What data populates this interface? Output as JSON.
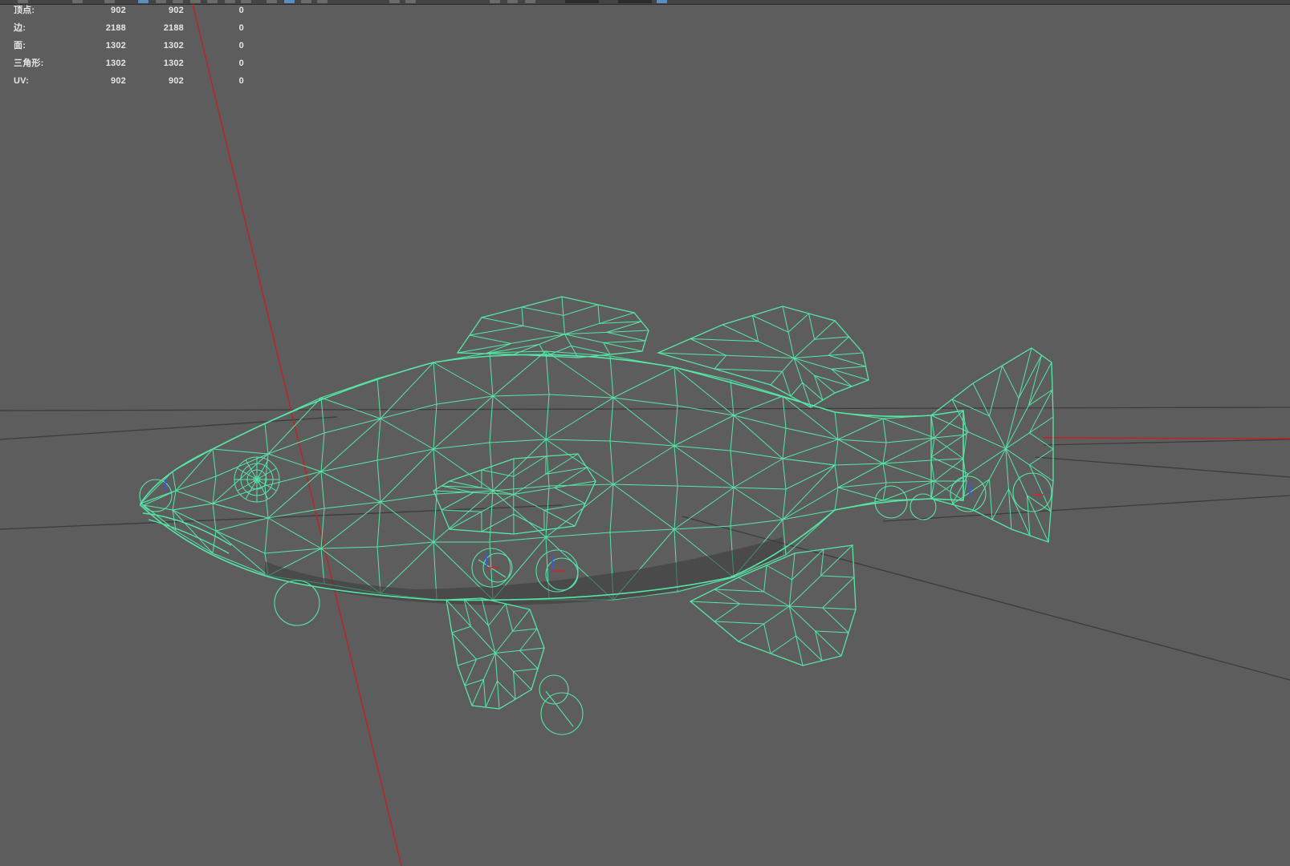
{
  "hud": {
    "rows": [
      {
        "label": "顶点:",
        "c1": "902",
        "c2": "902",
        "c3": "0"
      },
      {
        "label": "边:",
        "c1": "2188",
        "c2": "2188",
        "c3": "0"
      },
      {
        "label": "面:",
        "c1": "1302",
        "c2": "1302",
        "c3": "0"
      },
      {
        "label": "三角形:",
        "c1": "1302",
        "c2": "1302",
        "c3": "0"
      },
      {
        "label": "UV:",
        "c1": "902",
        "c2": "902",
        "c3": "0"
      }
    ]
  },
  "colors": {
    "viewport_bg": "#5d5d5d",
    "wireframe": "#55e6a6",
    "axis_red": "#c81e1e",
    "ground_grid": "#3c3c3c",
    "hud_text": "#e6e6e6"
  },
  "icons": [
    "toolbar-button-icons",
    "pivot-manipulator-icon"
  ]
}
